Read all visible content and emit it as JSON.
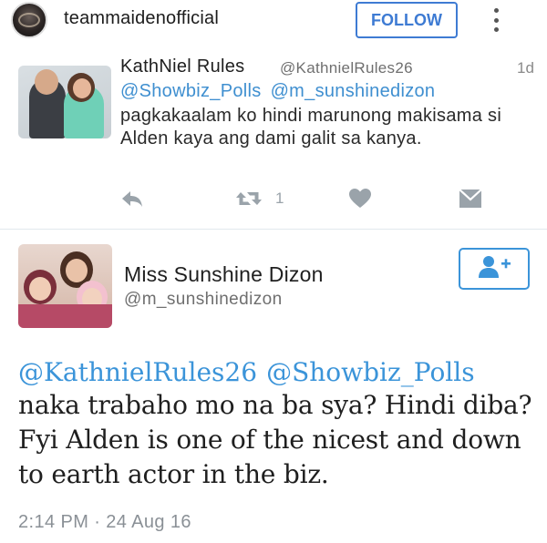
{
  "instagram_header": {
    "username": "teammaidenofficial",
    "follow_label": "FOLLOW"
  },
  "reply_tweet": {
    "display_name": "KathNiel Rules",
    "handle": "@KathnielRules26",
    "time": "1d",
    "mentions": [
      "@Showbiz_Polls",
      "@m_sunshinedizon"
    ],
    "text": "pagkakaalam ko hindi marunong makisama si Alden kaya ang dami galit sa kanya.",
    "retweet_count": "1",
    "actions": [
      "reply-icon",
      "retweet-icon",
      "like-icon",
      "message-icon"
    ]
  },
  "main_tweet": {
    "display_name": "Miss Sunshine Dizon",
    "handle": "@m_sunshinedizon",
    "mentions": [
      "@KathnielRules26",
      "@Showbiz_Polls"
    ],
    "text": "naka trabaho mo na ba sya? Hindi diba? Fyi Alden is one of the nicest and down to earth actor in the biz.",
    "timestamp": "2:14 PM · 24 Aug 16",
    "follow_icon": "add-user-icon"
  },
  "colors": {
    "link_blue": "#3b94d9",
    "follow_blue": "#3e7bd3",
    "action_gray": "#9aa3aa",
    "divider": "#e1e8ed"
  }
}
